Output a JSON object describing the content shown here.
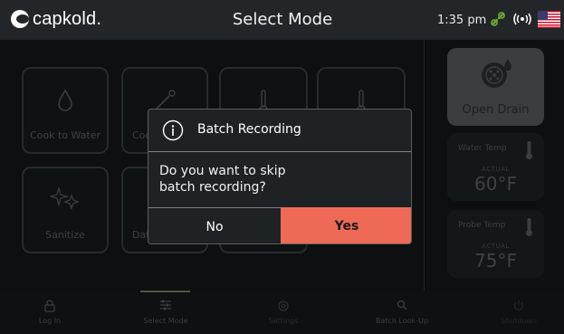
{
  "header": {
    "logo_text": "capkold.",
    "title": "Select Mode",
    "time": "1:35 pm",
    "icons": [
      "link-icon",
      "wireless-icon",
      "us-flag-icon"
    ]
  },
  "tiles": [
    {
      "label": "Cook to Water",
      "icon": "droplet-icon"
    },
    {
      "label": "Coo",
      "icon": "probe-icon"
    },
    {
      "label": "",
      "icon": "thermometer-icon"
    },
    {
      "label": "",
      "icon": "thermometer-icon"
    },
    {
      "label": "Sanitize",
      "icon": "sparkle-icon"
    },
    {
      "label": "Dat",
      "icon": ""
    }
  ],
  "side": {
    "drain_label": "Open Drain",
    "water_temp": {
      "title": "Water Temp",
      "actual_label": "ACTUAL",
      "value": "60°F"
    },
    "probe_temp": {
      "title": "Probe Temp",
      "actual_label": "ACTUAL",
      "value": "75°F"
    }
  },
  "bottom_nav": [
    {
      "label": "Log In",
      "icon": "lock-icon"
    },
    {
      "label": "Select Mode",
      "icon": "sliders-icon",
      "active": true
    },
    {
      "label": "Settings",
      "icon": "gear-icon"
    },
    {
      "label": "Batch Look-Up",
      "icon": "search-icon"
    },
    {
      "label": "Shutdown",
      "icon": "power-icon"
    }
  ],
  "modal": {
    "title": "Batch Recording",
    "message_line1": "Do you want to skip",
    "message_line2": "batch recording?",
    "no_label": "No",
    "yes_label": "Yes"
  },
  "colors": {
    "accent": "#ee6a57",
    "topbar": "#232628",
    "link_green": "#6aa534"
  }
}
